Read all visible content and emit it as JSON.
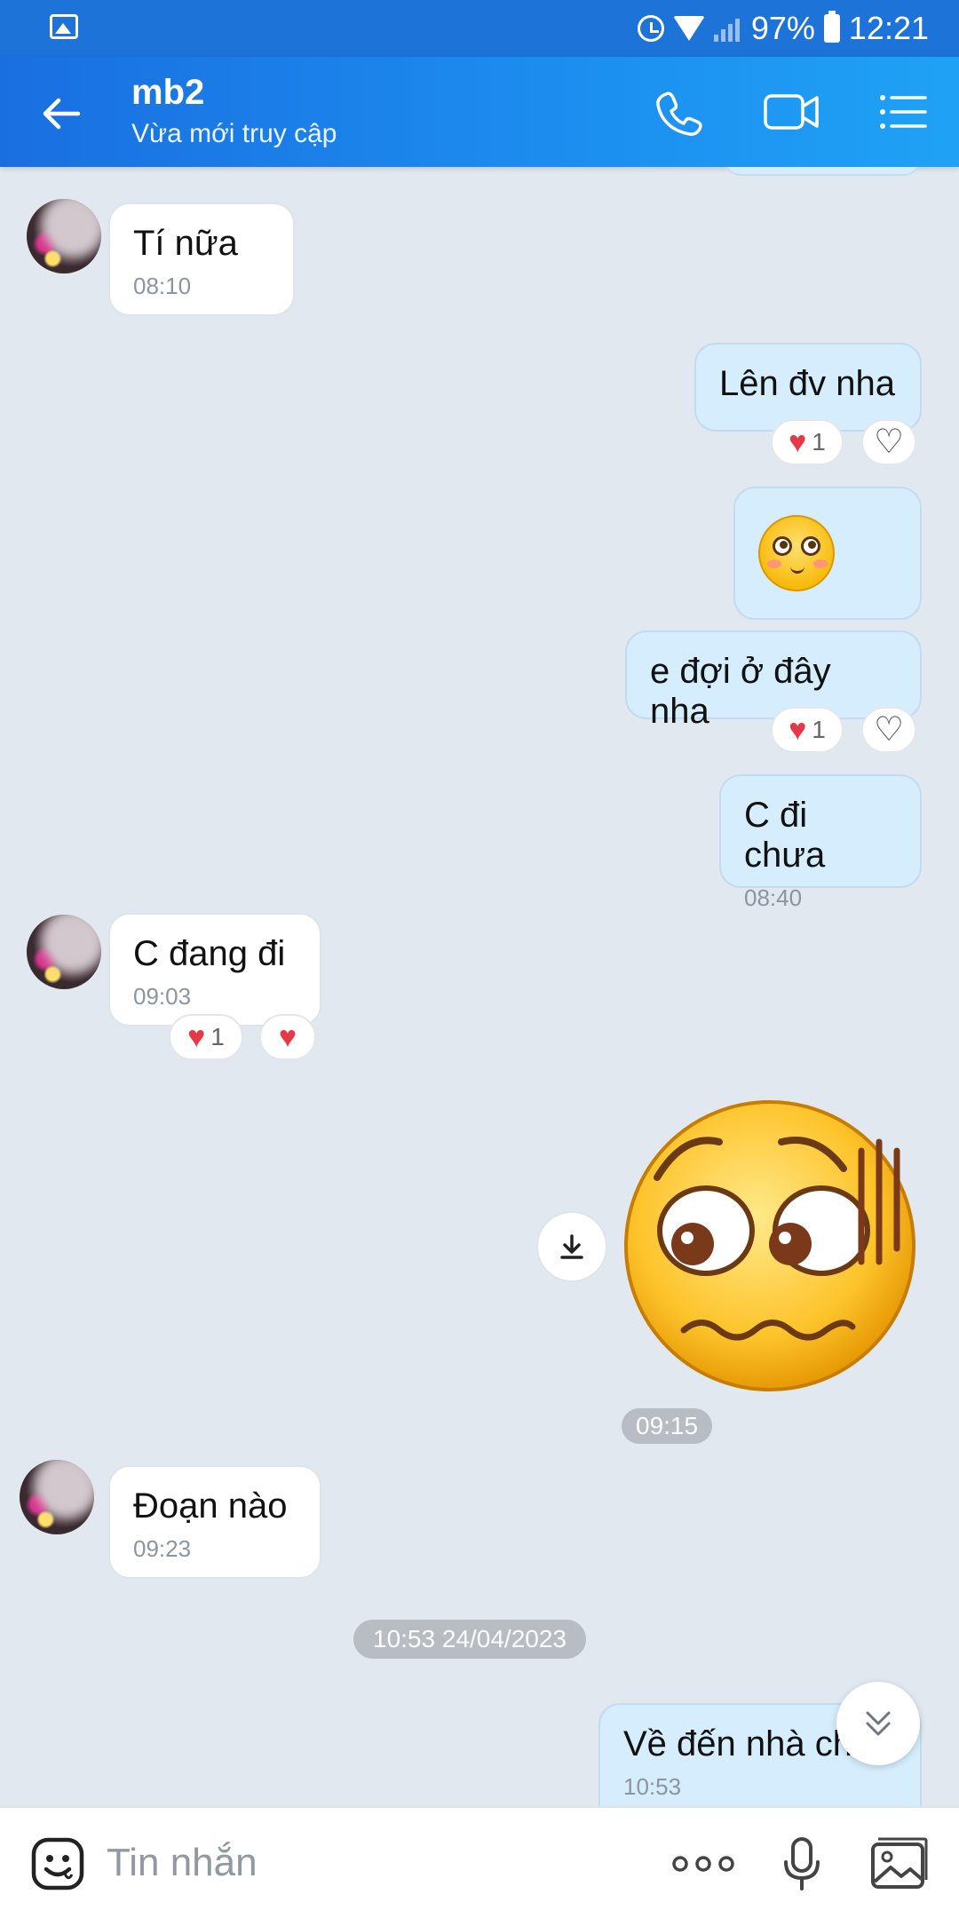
{
  "status_bar": {
    "battery_percent": "97%",
    "time": "12:21"
  },
  "header": {
    "contact_name": "mb2",
    "contact_status": "Vừa mới truy cập",
    "icons": [
      "back-arrow-icon",
      "phone-icon",
      "video-call-icon",
      "menu-list-icon"
    ]
  },
  "messages": [
    {
      "side": "in",
      "text": "Tí nữa",
      "time": "08:10"
    },
    {
      "side": "out",
      "text": "Lên đv nha",
      "reaction_count": "1"
    },
    {
      "side": "out",
      "sticker": "blushing-face-emoji"
    },
    {
      "side": "out",
      "text": "e đợi ở đây nha",
      "reaction_count": "1"
    },
    {
      "side": "out",
      "text": "C đi chưa",
      "time": "08:40"
    },
    {
      "side": "in",
      "text": "C đang đi",
      "time": "09:03",
      "reaction_count": "1"
    },
    {
      "side": "out",
      "sticker": "nervous-face-sticker",
      "time": "09:15"
    },
    {
      "side": "in",
      "text": "Đoạn nào",
      "time": "09:23"
    },
    {
      "side": "out",
      "text": "Về đến nhà ch",
      "time": "10:53"
    }
  ],
  "date_separator": "10:53 24/04/2023",
  "input": {
    "placeholder": "Tin nhắn"
  },
  "colors": {
    "header_start": "#1a6fe0",
    "header_end": "#1fa2f5",
    "chat_background": "#e2e8f0",
    "outgoing_bubble": "#d5edfc",
    "incoming_bubble": "#ffffff",
    "reaction_heart": "#e53946"
  }
}
